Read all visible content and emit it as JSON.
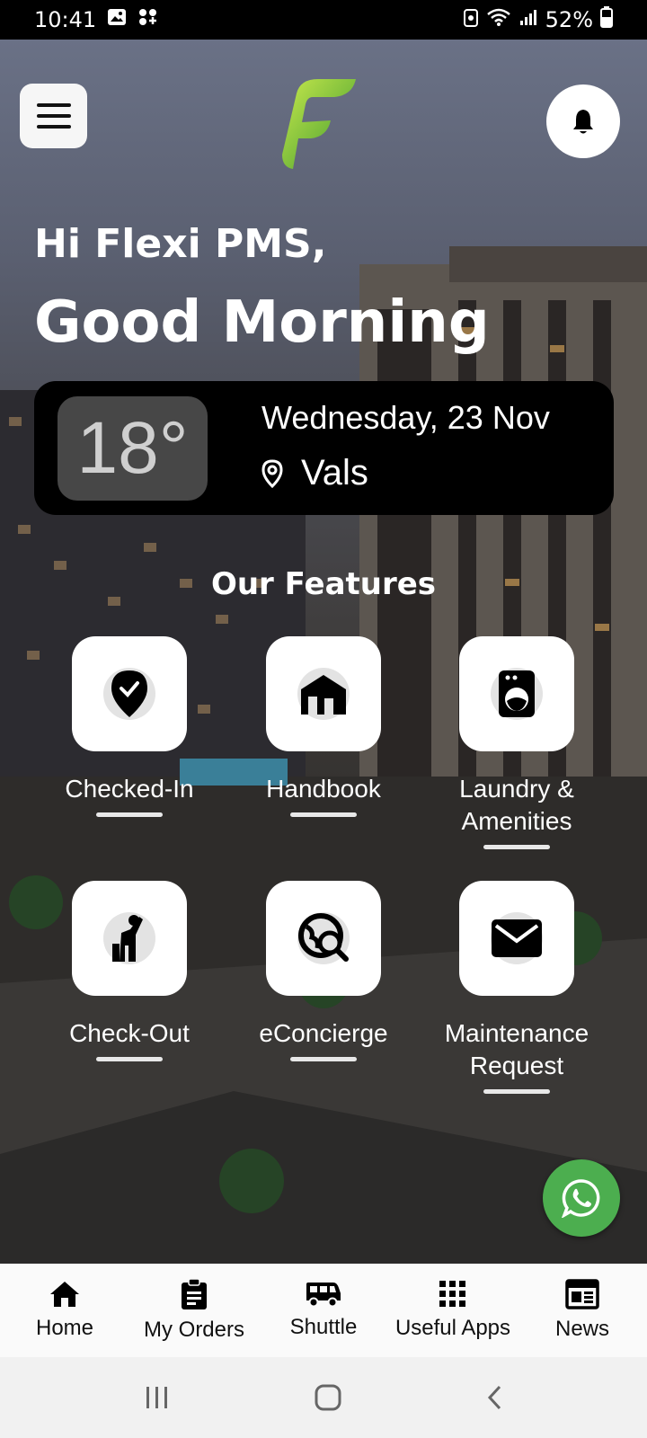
{
  "status_bar": {
    "time": "10:41",
    "battery": "52%"
  },
  "header": {
    "greeting": "Hi Flexi PMS,",
    "salutation": "Good Morning"
  },
  "weather": {
    "temperature": "18°",
    "date": "Wednesday, 23 Nov",
    "location": "Vals"
  },
  "features": {
    "title": "Our Features",
    "items": [
      {
        "label": "Checked-In",
        "icon": "location-check-icon"
      },
      {
        "label": "Handbook",
        "icon": "home-icon"
      },
      {
        "label": "Laundry & Amenities",
        "icon": "washing-machine-icon"
      },
      {
        "label": "Check-Out",
        "icon": "person-leaving-icon"
      },
      {
        "label": "eConcierge",
        "icon": "globe-search-icon"
      },
      {
        "label": "Maintenance Request",
        "icon": "envelope-icon"
      }
    ]
  },
  "bottom_nav": {
    "items": [
      {
        "label": "Home",
        "icon": "home-icon"
      },
      {
        "label": "My Orders",
        "icon": "clipboard-icon"
      },
      {
        "label": "Shuttle",
        "icon": "shuttle-icon"
      },
      {
        "label": "Useful Apps",
        "icon": "grid-icon"
      },
      {
        "label": "News",
        "icon": "newspaper-icon"
      }
    ]
  },
  "colors": {
    "brand_green": "#7cc142",
    "whatsapp_green": "#4cae4f",
    "card_bg": "#000000",
    "temp_box_bg": "#474747"
  }
}
